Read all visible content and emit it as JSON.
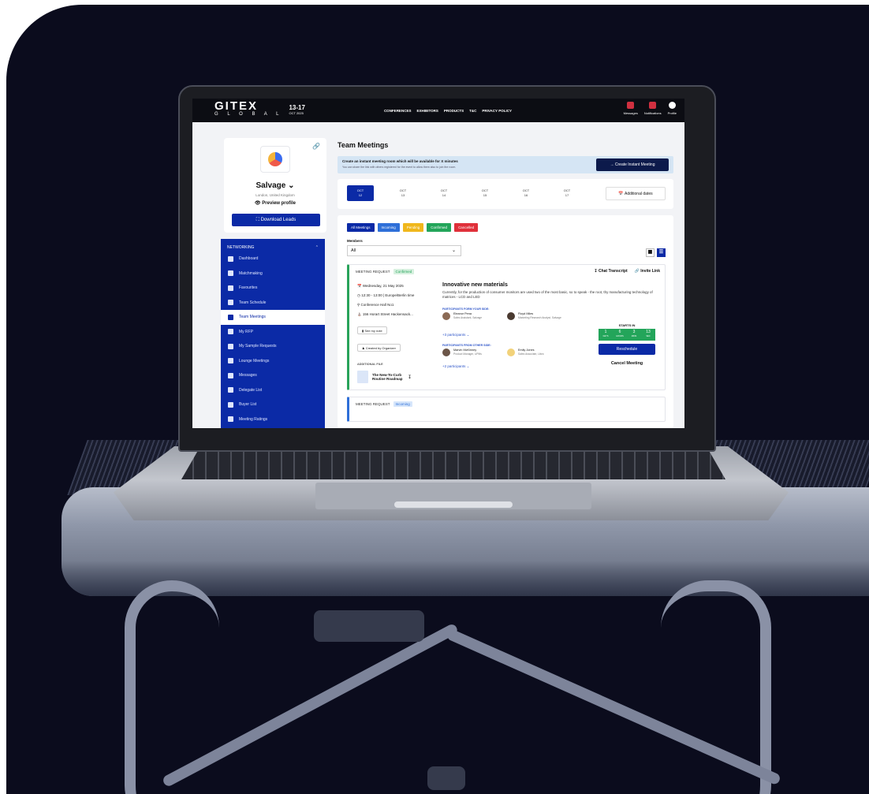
{
  "topbar": {
    "logo": "GITEX",
    "logo_sub": "G L O B A L",
    "dates": "13-17",
    "dates_sub": "OCT 2025",
    "nav": [
      "CONFERENCES",
      "EXHIBITORS",
      "PRODUCTS",
      "T&C",
      "PRIVACY POLICY"
    ],
    "icons": [
      {
        "label": "Messages",
        "icon": "message-icon"
      },
      {
        "label": "Notifications",
        "icon": "bell-icon"
      },
      {
        "label": "Profile",
        "icon": "profile-icon"
      }
    ]
  },
  "profile": {
    "company": "Salvage",
    "location": "London, United Kingdom",
    "preview": "Preview profile",
    "download": "Download Leads"
  },
  "sidebar": {
    "section": "NETWORKING",
    "items": [
      {
        "label": "Dashboard"
      },
      {
        "label": "Matchmaking"
      },
      {
        "label": "Favourites"
      },
      {
        "label": "Team Schedule"
      },
      {
        "label": "Team Meetings"
      },
      {
        "label": "My RFP"
      },
      {
        "label": "My Sample Requests"
      },
      {
        "label": "Lounge Meetings"
      },
      {
        "label": "Messages"
      },
      {
        "label": "Delegate List"
      },
      {
        "label": "Buyer List"
      },
      {
        "label": "Meeting Ratings"
      }
    ],
    "active_index": 4
  },
  "main": {
    "title": "Team Meetings",
    "banner_title": "Create an instant meeting room which will be available for X minutes",
    "banner_sub": "You can share the link with others registered for the event to allow them also to join the room.",
    "instant_btn": "Create Instant Meeting",
    "dates": [
      {
        "month": "OCT",
        "day": "12"
      },
      {
        "month": "OCT",
        "day": "13"
      },
      {
        "month": "OCT",
        "day": "14"
      },
      {
        "month": "OCT",
        "day": "15"
      },
      {
        "month": "OCT",
        "day": "16"
      },
      {
        "month": "OCT",
        "day": "17"
      }
    ],
    "additional_dates": "Additional dates",
    "filters": [
      {
        "label": "All Meetings",
        "color": "#0b2aa6"
      },
      {
        "label": "Incoming",
        "color": "#2e6fd8"
      },
      {
        "label": "Pending",
        "color": "#f0b71c"
      },
      {
        "label": "Confirmed",
        "color": "#23a55a"
      },
      {
        "label": "Cancelled",
        "color": "#e0303a"
      }
    ],
    "members_label": "Members",
    "members_value": "All"
  },
  "meeting": {
    "type": "MEETING REQUEST",
    "status": "Confirmed",
    "chat": "Chat Transcript",
    "invite": "Invite Link",
    "date": "Wednesday, 21 May 2025",
    "time": "12:30 - 13:00 | Europe/Berlin time",
    "room": "Conference Hall No1",
    "address": "156 Horart Street Hackensack...",
    "note_btn": "See my note",
    "created_by": "Created by Organizer",
    "additional_file": "ADDITIONAL FILE",
    "file_name": "The New-To-Curb Routine Roadmap",
    "title": "Innovative new materials",
    "description": "Currently, for the production of consumer monitors are used two of the most basic, so to speak - the root, thy manufacturing technology of matrices - LCD and LED",
    "your_side": "PARTICIPANTS FORM YOUR SIDE:",
    "other_side": "PARTICIPANTS FROM OTHER SIDE:",
    "participants_yours": [
      {
        "name": "Eleanor Pena",
        "role": "Sales Assistant, Salvage"
      },
      {
        "name": "Floyd Miles",
        "role": "Marketing Research Analyst, Salvage"
      }
    ],
    "more_yours": "+3 participants",
    "participants_other": [
      {
        "name": "Marvin McKinney",
        "role": "Product Manager, UPMs"
      },
      {
        "name": "Emily Jones",
        "role": "Sales Associate, Libra"
      }
    ],
    "more_other": "+2 participants",
    "starts_in": "STARTS IN",
    "countdown": [
      {
        "value": "1",
        "unit": "DAYS"
      },
      {
        "value": "6",
        "unit": "HOURS"
      },
      {
        "value": "3",
        "unit": "MINS"
      },
      {
        "value": "13",
        "unit": "SEC"
      }
    ],
    "reschedule": "Reschedule",
    "cancel": "Cancel Meeting"
  },
  "meeting2": {
    "type": "MEETING REQUEST",
    "status": "Incoming"
  }
}
